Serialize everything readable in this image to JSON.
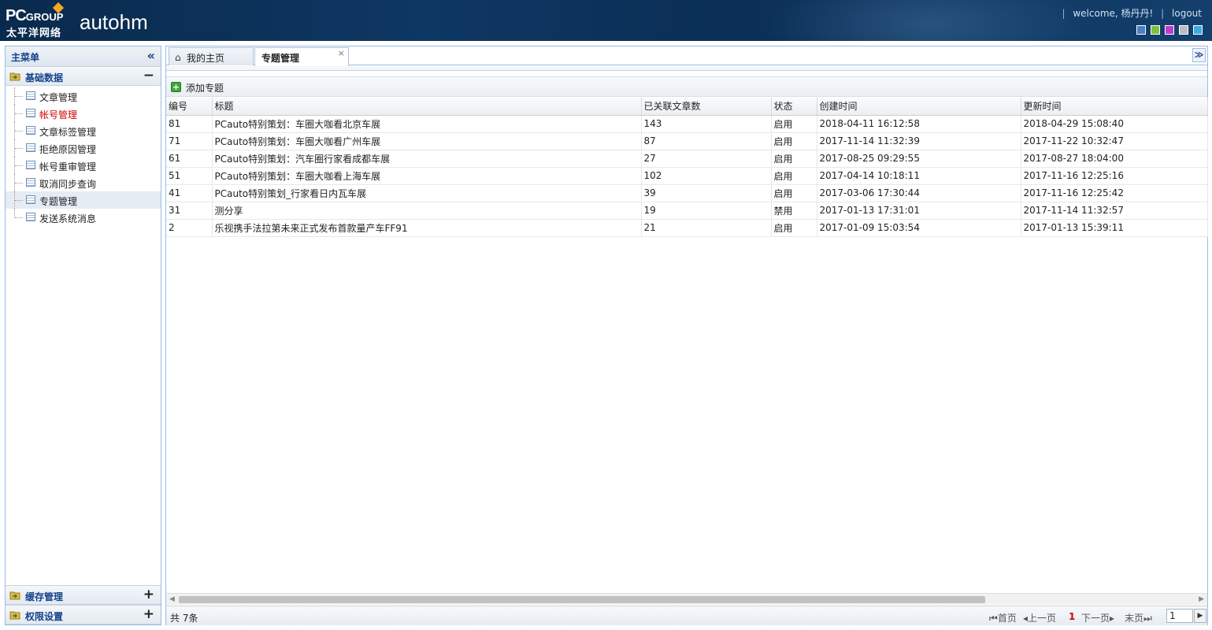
{
  "header": {
    "logo_text_main": "PC",
    "logo_text_group": "GROUP",
    "logo_text_cn": "太平洋网络",
    "app_title": "autohm",
    "separator": "|",
    "welcome": "welcome, 杨丹丹!",
    "logout": "logout",
    "theme_colors": [
      "#4a7fc1",
      "#7ac142",
      "#c03ccf",
      "#bdbdbd",
      "#3fa9e0"
    ]
  },
  "sidebar": {
    "title": "主菜单",
    "collapse_glyph": "«",
    "groups": [
      {
        "label": "基础数据",
        "toggle": "−",
        "items": [
          {
            "label": "文章管理"
          },
          {
            "label": "帐号管理"
          },
          {
            "label": "文章标签管理"
          },
          {
            "label": "拒绝原因管理"
          },
          {
            "label": "帐号重审管理"
          },
          {
            "label": "取消同步查询"
          },
          {
            "label": "专题管理"
          },
          {
            "label": "发送系统消息"
          }
        ]
      },
      {
        "label": "缓存管理",
        "toggle": "+"
      },
      {
        "label": "权限设置",
        "toggle": "+"
      }
    ]
  },
  "tabs": [
    {
      "label": "我的主页",
      "icon": "home-icon"
    },
    {
      "label": "专题管理",
      "close": "×"
    }
  ],
  "tabmenu_glyph": "≫",
  "toolbar": {
    "add_label": "添加专题",
    "add_glyph": "+"
  },
  "table": {
    "columns": [
      "编号",
      "标题",
      "已关联文章数",
      "状态",
      "创建时间",
      "更新时间"
    ],
    "rows": [
      [
        "81",
        "PCauto特别策划：车圈大咖看北京车展",
        "143",
        "启用",
        "2018-04-11 16:12:58",
        "2018-04-29 15:08:40"
      ],
      [
        "71",
        "PCauto特别策划：车圈大咖看广州车展",
        "87",
        "启用",
        "2017-11-14 11:32:39",
        "2017-11-22 10:32:47"
      ],
      [
        "61",
        "PCauto特别策划：汽车圈行家看成都车展",
        "27",
        "启用",
        "2017-08-25 09:29:55",
        "2017-08-27 18:04:00"
      ],
      [
        "51",
        "PCauto特别策划：车圈大咖看上海车展",
        "102",
        "启用",
        "2017-04-14 10:18:11",
        "2017-11-16 12:25:16"
      ],
      [
        "41",
        "PCauto特别策划_行家看日内瓦车展",
        "39",
        "启用",
        "2017-03-06 17:30:44",
        "2017-11-16 12:25:42"
      ],
      [
        "31",
        "测分享",
        "19",
        "禁用",
        "2017-01-13 17:31:01",
        "2017-11-14 11:32:57"
      ],
      [
        "2",
        "乐视携手法拉第未来正式发布首款量产车FF91",
        "21",
        "启用",
        "2017-01-09 15:03:54",
        "2017-01-13 15:39:11"
      ]
    ]
  },
  "pager": {
    "total": "共 7条",
    "first": "首页",
    "prev": "上一页",
    "current": "1",
    "next": "下一页",
    "last": "末页",
    "page_input": "1"
  }
}
